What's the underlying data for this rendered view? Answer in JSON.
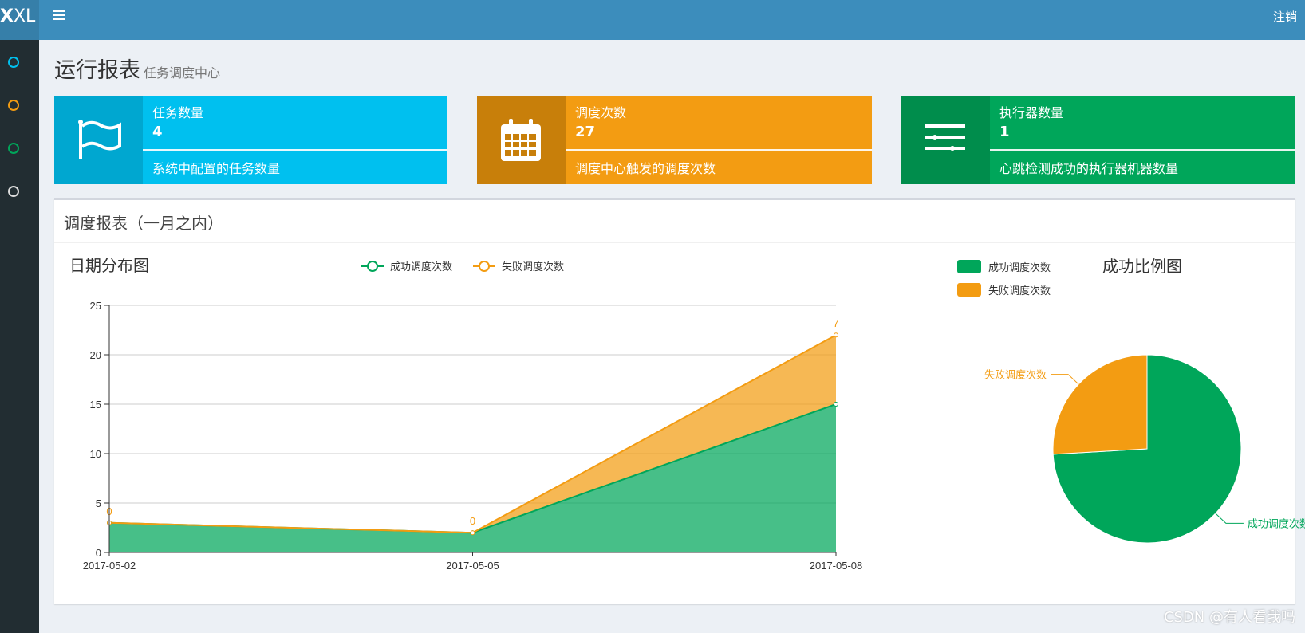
{
  "logo": {
    "bold": "X",
    "rest": "XL"
  },
  "sidebar": {
    "dot_colors": [
      "#00c0ef",
      "#f39c12",
      "#00a65a",
      "#dddddd"
    ]
  },
  "topbar": {
    "logout_label": "注销"
  },
  "page": {
    "title": "运行报表",
    "subtitle": "任务调度中心"
  },
  "info_boxes": [
    {
      "title": "任务数量",
      "number": "4",
      "description": "系统中配置的任务数量",
      "color": "#00c0ef",
      "icon_bg": "#00a7d0",
      "icon": "flag-icon"
    },
    {
      "title": "调度次数",
      "number": "27",
      "description": "调度中心触发的调度次数",
      "color": "#f39c12",
      "icon_bg": "#c87f0a",
      "icon": "calendar-icon"
    },
    {
      "title": "执行器数量",
      "number": "1",
      "description": "心跳检测成功的执行器机器数量",
      "color": "#00a65a",
      "icon_bg": "#008d4c",
      "icon": "sliders-icon"
    }
  ],
  "report": {
    "title": "调度报表（一月之内）"
  },
  "chart_data": [
    {
      "type": "area",
      "title": "日期分布图",
      "categories": [
        "2017-05-02",
        "2017-05-05",
        "2017-05-08"
      ],
      "stacked": true,
      "series": [
        {
          "name": "成功调度次数",
          "values": [
            3,
            2,
            15
          ],
          "color": "#00a65a"
        },
        {
          "name": "失败调度次数",
          "values": [
            0,
            0,
            7
          ],
          "color": "#f39c12"
        }
      ],
      "ylim": [
        0,
        25
      ],
      "yticks": [
        0,
        5,
        10,
        15,
        20,
        25
      ],
      "grid": true,
      "legend": "top-center"
    },
    {
      "type": "pie",
      "title": "成功比例图",
      "slices": [
        {
          "name": "成功调度次数",
          "value": 20,
          "color": "#00a65a"
        },
        {
          "name": "失败调度次数",
          "value": 7,
          "color": "#f39c12"
        }
      ],
      "legend": "top-left"
    }
  ],
  "watermark": "CSDN @有人看我吗"
}
